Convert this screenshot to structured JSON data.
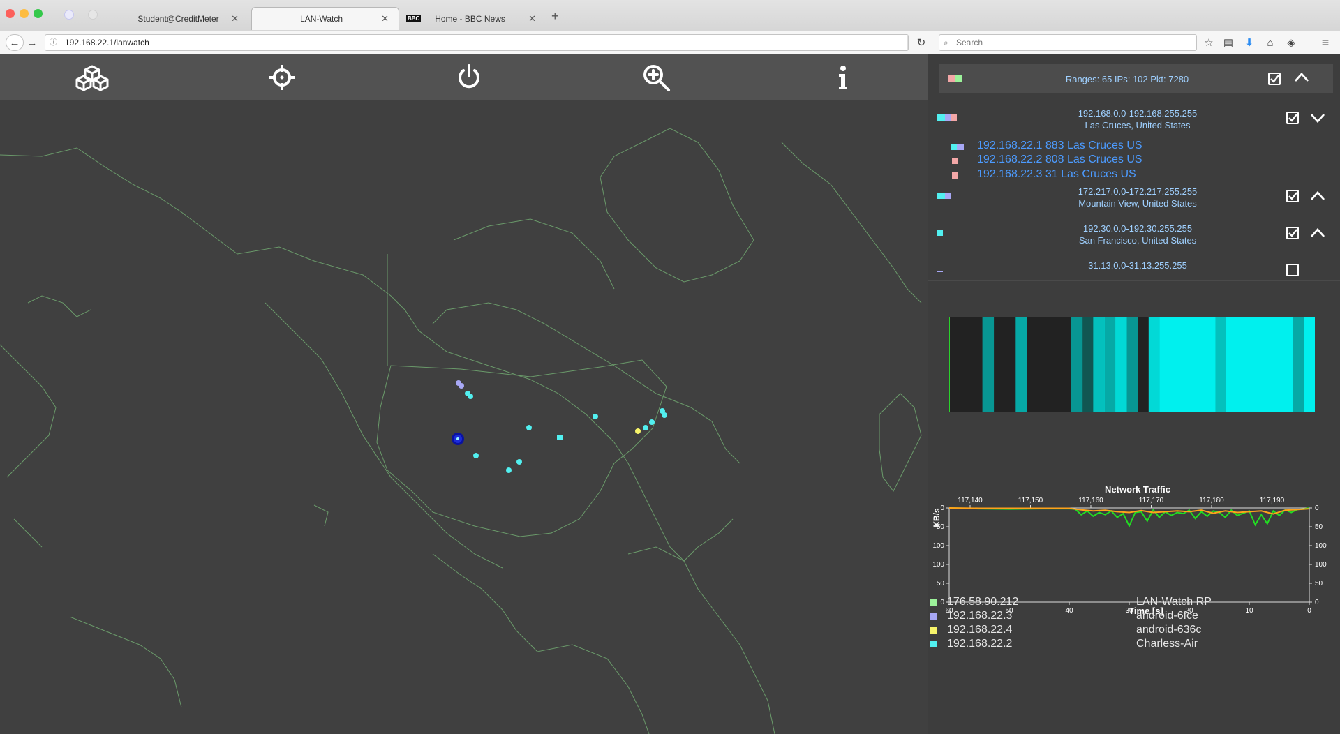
{
  "browser": {
    "tabs": [
      {
        "title": "Student@CreditMeter",
        "active": false
      },
      {
        "title": "LAN-Watch",
        "active": true
      },
      {
        "title": "Home - BBC News",
        "active": false
      }
    ],
    "url": "192.168.22.1/lanwatch",
    "search_placeholder": "Search"
  },
  "toolbar": {
    "icons": [
      "cubes-icon",
      "crosshair-icon",
      "power-icon",
      "zoom-in-icon",
      "info-icon"
    ]
  },
  "summary": {
    "text": "Ranges: 65  IPs: 102  Pkt: 7280"
  },
  "ranges": [
    {
      "range": "192.168.0.0-192.168.255.255",
      "location": "Las Cruces, United States",
      "expanded": true,
      "ips": [
        {
          "text": "192.168.22.1 883  Las Cruces  US"
        },
        {
          "text": "192.168.22.2 808  Las Cruces  US"
        },
        {
          "text": "192.168.22.3 31  Las Cruces  US"
        }
      ]
    },
    {
      "range": "172.217.0.0-172.217.255.255",
      "location": "Mountain View, United States",
      "expanded": false
    },
    {
      "range": "192.30.0.0-192.30.255.255",
      "location": "San Francisco, United States",
      "expanded": false
    },
    {
      "range": "31.13.0.0-31.13.255.255",
      "location": "",
      "expanded": false
    }
  ],
  "chart_data": {
    "type": "line",
    "title": "Network Traffic",
    "xlabel": "Time [s]",
    "ylabel": "KB/s",
    "x_ticks": [
      "60",
      "50",
      "40",
      "30",
      "20",
      "10",
      "0"
    ],
    "top_ticks": [
      "117,140",
      "117,150",
      "117,160",
      "117,170",
      "117,180",
      "117,190"
    ],
    "y_ticks_left": [
      "0",
      "50",
      "100",
      "100",
      "50",
      "0"
    ],
    "y_ticks_right": [
      "0",
      "50",
      "100",
      "100",
      "50",
      "0"
    ],
    "ylim": [
      0,
      100
    ],
    "series": [
      {
        "color": "#22dd22",
        "x": [
          60,
          55,
          50,
          45,
          40,
          39,
          38,
          37,
          36,
          35,
          34,
          33,
          32,
          31,
          30,
          29,
          28,
          27,
          26,
          25,
          24,
          23,
          22,
          21,
          20,
          19,
          18,
          17,
          16,
          15,
          14,
          13,
          12,
          11,
          10,
          9,
          8,
          7,
          6,
          5,
          4,
          3,
          2,
          1,
          0
        ],
        "values": [
          0,
          2,
          3,
          2,
          2,
          3,
          18,
          8,
          22,
          12,
          18,
          8,
          25,
          15,
          48,
          12,
          10,
          35,
          5,
          25,
          10,
          20,
          12,
          15,
          6,
          28,
          10,
          22,
          8,
          12,
          25,
          6,
          20,
          14,
          8,
          45,
          18,
          42,
          8,
          20,
          5,
          12,
          4,
          3,
          0
        ]
      },
      {
        "color": "#ffa21a",
        "x": [
          60,
          55,
          50,
          45,
          40,
          38,
          36,
          34,
          32,
          30,
          28,
          26,
          24,
          22,
          20,
          18,
          16,
          14,
          12,
          10,
          8,
          6,
          4,
          2,
          0
        ],
        "values": [
          0,
          1,
          1,
          1,
          1,
          5,
          8,
          6,
          10,
          12,
          7,
          12,
          10,
          8,
          10,
          6,
          14,
          8,
          12,
          10,
          8,
          16,
          6,
          4,
          2
        ]
      }
    ]
  },
  "activity": {
    "bands": [
      0,
      0,
      0,
      0.6,
      0,
      0,
      0.7,
      0,
      0,
      0,
      0,
      0.6,
      0.2,
      0.8,
      0.7,
      0.9,
      0.6,
      0,
      0.9,
      1,
      1,
      1,
      1,
      1,
      0.8,
      1,
      1,
      1,
      1,
      1,
      1,
      0.7,
      1
    ]
  },
  "legend": [
    {
      "ip": "176.58.90.212",
      "name": "LAN-Watch RP",
      "color": "#9cf29a"
    },
    {
      "ip": "192.168.22.3",
      "name": "android-6fce",
      "color": "#a8a8f5"
    },
    {
      "ip": "192.168.22.4",
      "name": "android-636c",
      "color": "#f7f46a"
    },
    {
      "ip": "192.168.22.2",
      "name": "Charless-Air",
      "color": "#52f0f0"
    }
  ],
  "colors": {
    "map_line": "#6a9a6a",
    "link": "#8fc4ff",
    "cyan": "#00f0ee"
  }
}
